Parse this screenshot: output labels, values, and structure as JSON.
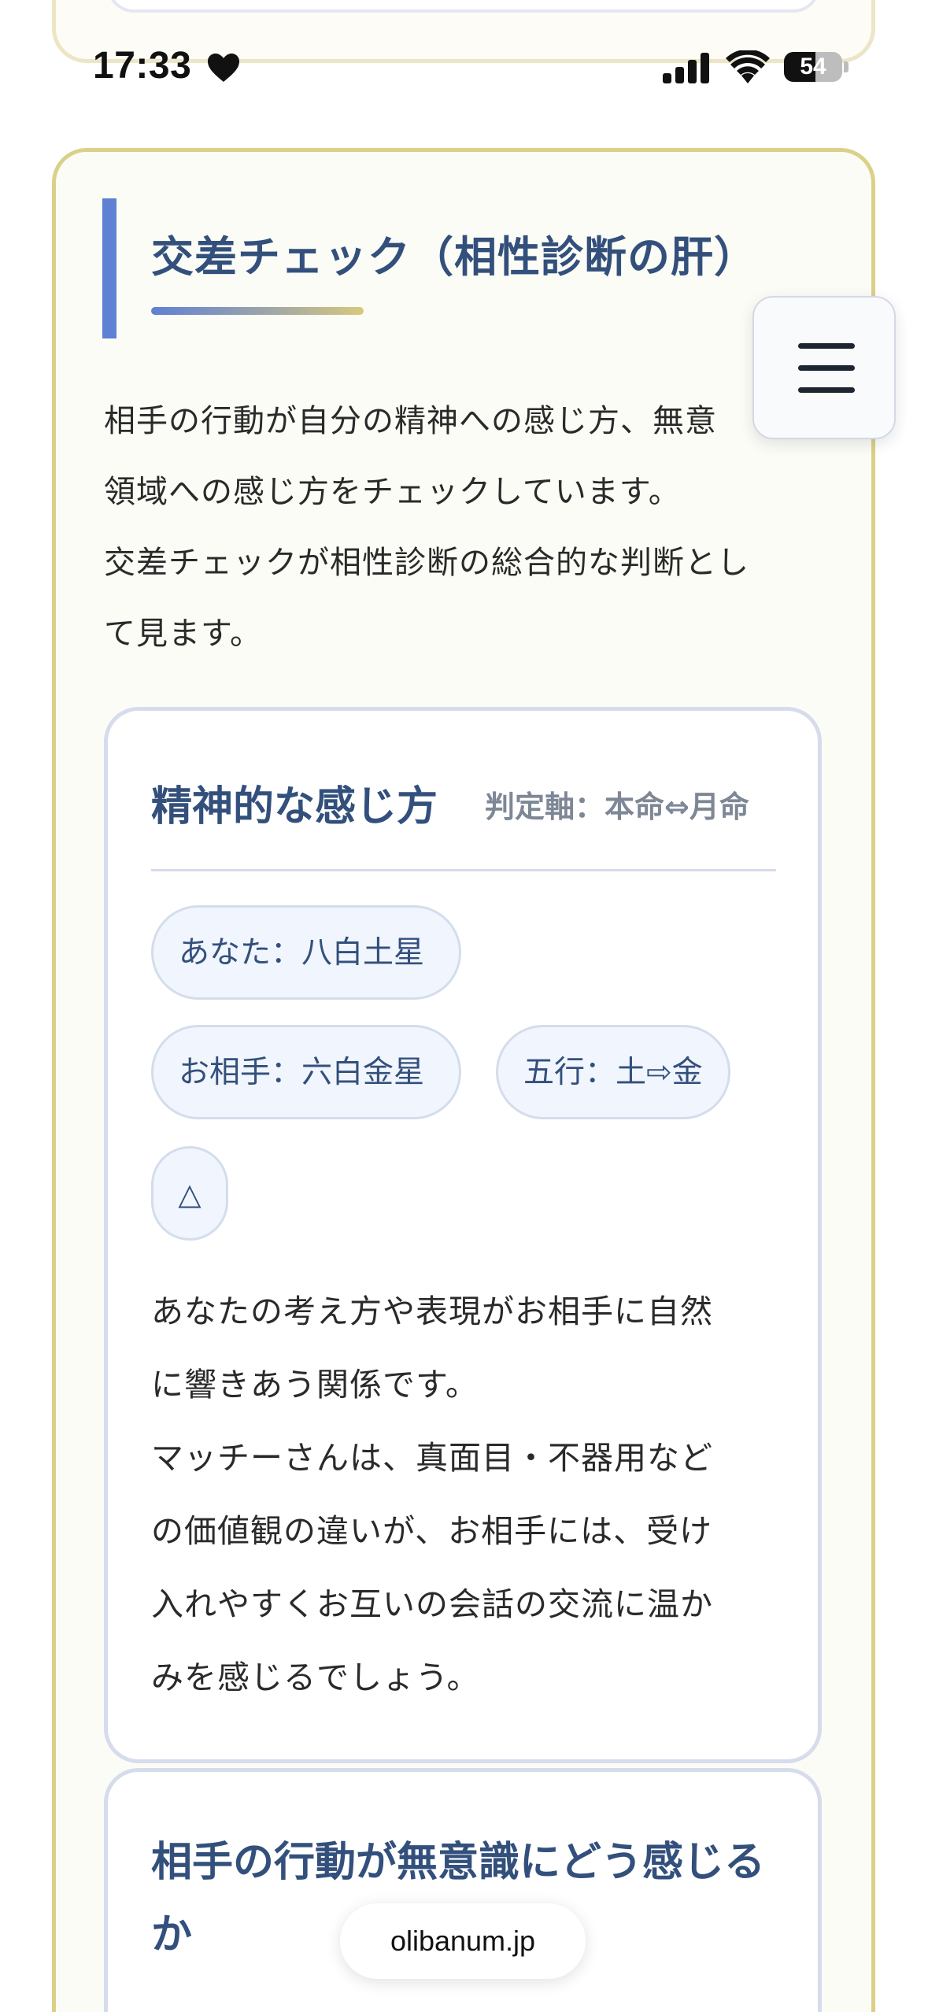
{
  "status_bar": {
    "time": "17:33",
    "battery_level": "54",
    "battery_fraction": 0.54
  },
  "section": {
    "title": "交差チェック（相性診断の肝）",
    "intro_lines": [
      "相手の行動が自分の精神への感じ方、無意",
      "領域への感じ方をチェックしています。",
      "交差チェックが相性診断の総合的な判断とし",
      "て見ます。"
    ]
  },
  "menu": {
    "icon": "hamburger-menu-icon"
  },
  "spiritual_card": {
    "title": "精神的な感じ方",
    "axis_label": "判定軸：本命⇔月命",
    "pills": {
      "you": "あなた：八白土星",
      "partner": "お相手：六白金星",
      "element": "五行：土⇨金",
      "verdict": "△"
    },
    "body_lines": [
      "あなたの考え方や表現がお相手に自然",
      "に響きあう関係です。",
      "マッチーさんは、真面目・不器用など",
      "の価値観の違いが、お相手には、受け",
      "入れやすくお互いの会話の交流に温か",
      "みを感じるでしょう。"
    ]
  },
  "unconscious_card": {
    "title_lines": [
      "相手の行動が無意識にどう感じる",
      "か"
    ]
  },
  "browser": {
    "url": "olibanum.jp"
  },
  "colors": {
    "accent_blue": "#5f81d4",
    "title_navy": "#33507c",
    "card_gold_border": "#dcd089",
    "pill_bg": "#f1f5fd"
  }
}
